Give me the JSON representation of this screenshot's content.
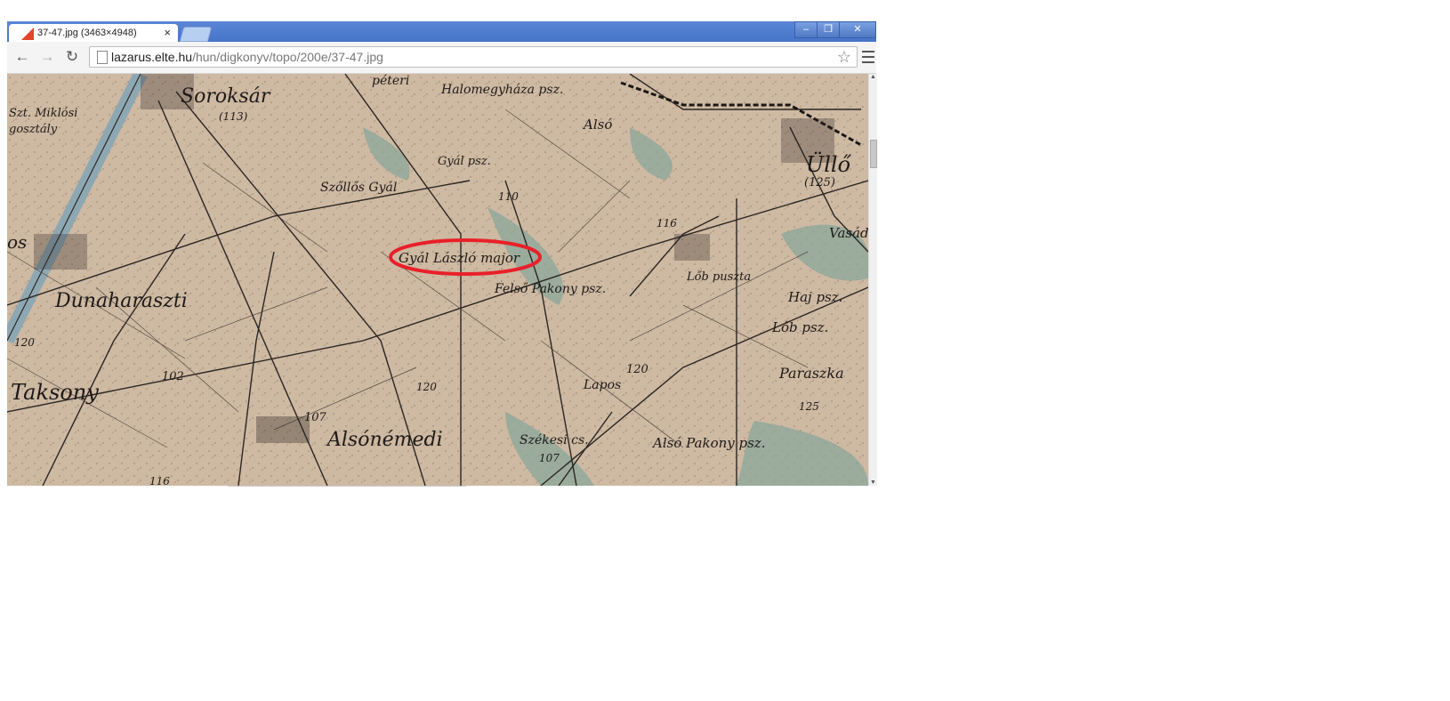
{
  "tab": {
    "title": "37-47.jpg (3463×4948)",
    "close_icon": "close-icon",
    "favicon": "image-favicon"
  },
  "window": {
    "minimize": "–",
    "restore": "❐",
    "close": "✕"
  },
  "nav": {
    "back": "←",
    "forward": "→",
    "reload": "↻"
  },
  "address": {
    "host": "lazarus.elte.hu",
    "path": "/hun/digkonyv/topo/200e/37-47.jpg",
    "star": "☆"
  },
  "map": {
    "labels": {
      "soroksar": "Soroksár",
      "soroksar_height": "(113)",
      "peteri": "péteri",
      "halomegyhaza": "Halomegyháza psz.",
      "szt_miklos": "Szt. Miklósi",
      "gosztalu": "gosztály",
      "also": "Alsó",
      "gyal_psz": "Gyál psz.",
      "ullo": "Üllő",
      "ullo_height": "(125)",
      "szollos_gyal": "Szőllős Gyál",
      "h110": "110",
      "h116": "116",
      "vasad": "Vasád",
      "gyal_laszlo": "Gyál László major",
      "felso_pakony": "Felső Pakony psz.",
      "lob_puszta": "Lőb puszta",
      "hajpsz": "Haj psz.",
      "dunaharaszti": "Dunaharaszti",
      "h120_left": "120",
      "lob_psz": "Lőb psz.",
      "h102": "102",
      "lapos": "Lapos",
      "h120_mid": "120",
      "paraszka": "Paraszka",
      "taksony": "Taksony",
      "h120_road": "120",
      "h125": "125",
      "h107": "107",
      "alsonemedi": "Alsónémedi",
      "szekesi": "Székesi cs.",
      "also_pakony": "Alsó Pakony psz.",
      "h107_bottom": "107",
      "h116_bottom": "116",
      "os": "os"
    },
    "annotation_color": "#e8202a"
  }
}
